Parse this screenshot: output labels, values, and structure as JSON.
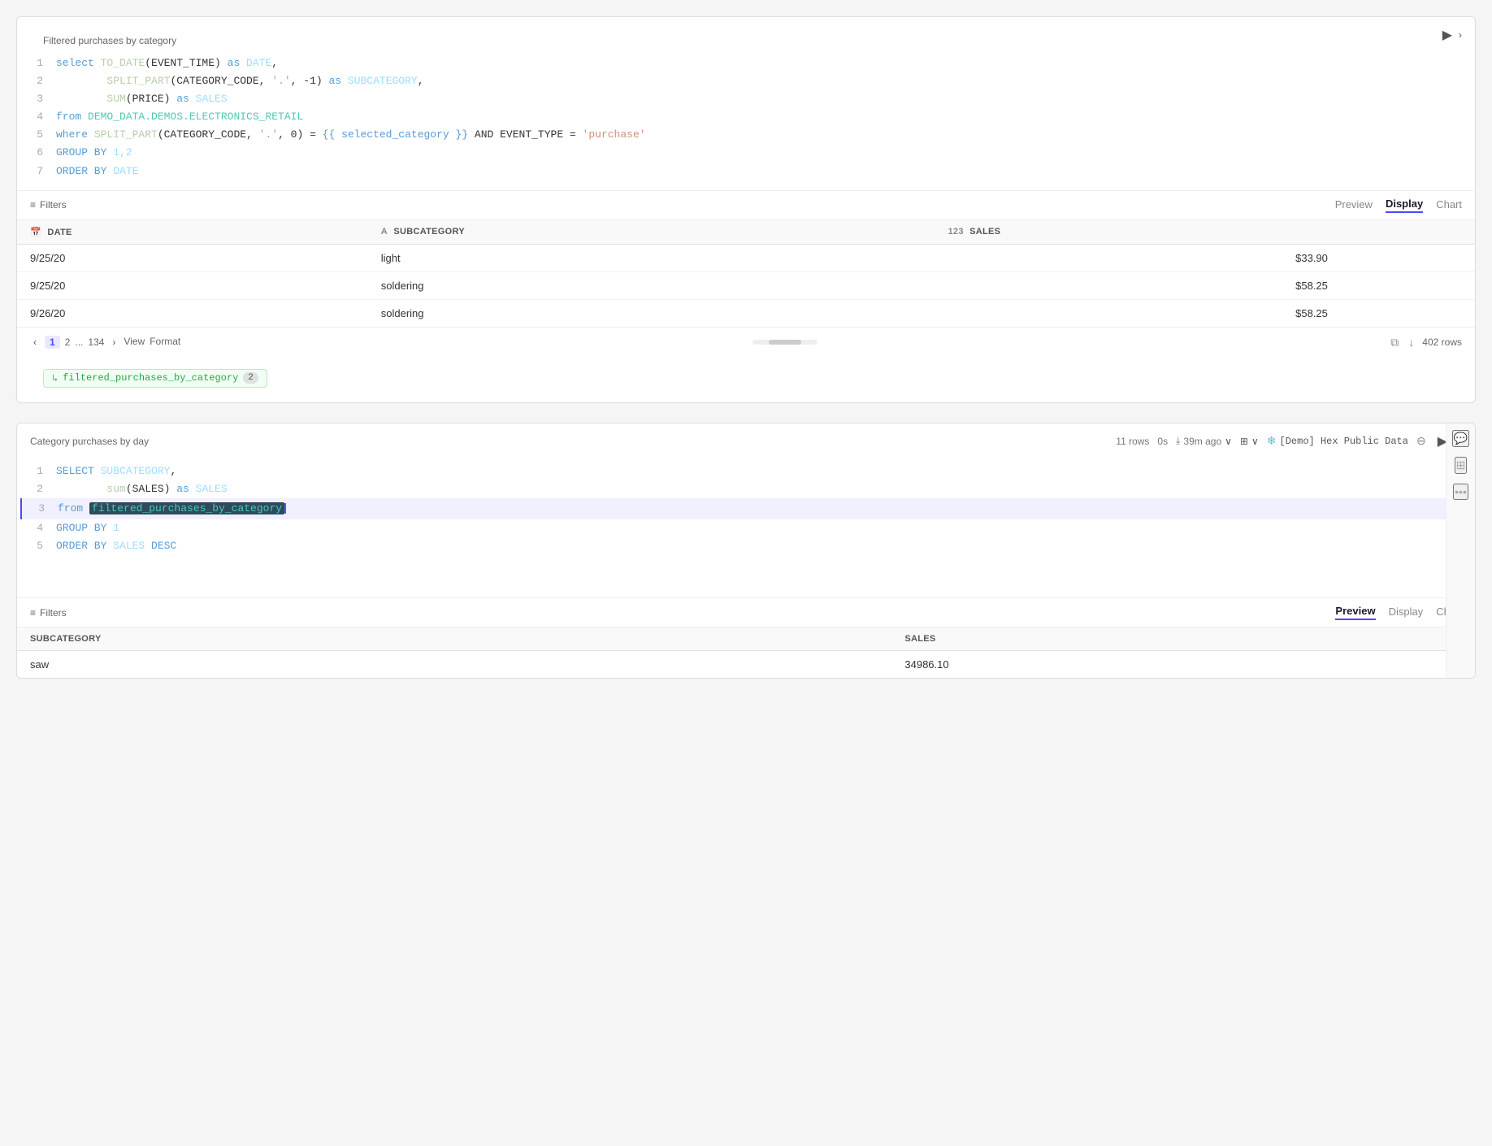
{
  "cell1": {
    "title": "Filtered purchases by category",
    "code": [
      {
        "lineNum": "1",
        "parts": [
          {
            "text": "select ",
            "class": "kw"
          },
          {
            "text": "TO_DATE",
            "class": "fn"
          },
          {
            "text": "(EVENT_TIME) "
          },
          {
            "text": "as ",
            "class": "kw"
          },
          {
            "text": "DATE",
            "class": "col"
          },
          {
            "text": ","
          }
        ]
      },
      {
        "lineNum": "2",
        "parts": [
          {
            "text": "        "
          },
          {
            "text": "SPLIT_PART",
            "class": "fn"
          },
          {
            "text": "(CATEGORY_CODE, "
          },
          {
            "text": "'.'",
            "class": "str"
          },
          {
            "text": ", -1) "
          },
          {
            "text": "as ",
            "class": "kw"
          },
          {
            "text": "SUBCATEGORY",
            "class": "col"
          },
          {
            "text": ","
          }
        ]
      },
      {
        "lineNum": "3",
        "parts": [
          {
            "text": "        "
          },
          {
            "text": "SUM",
            "class": "fn"
          },
          {
            "text": "(PRICE) "
          },
          {
            "text": "as ",
            "class": "kw"
          },
          {
            "text": "SALES",
            "class": "col"
          }
        ]
      },
      {
        "lineNum": "4",
        "parts": [
          {
            "text": "from ",
            "class": "kw"
          },
          {
            "text": "DEMO_DATA.DEMOS.ELECTRONICS_RETAIL",
            "class": "ref"
          }
        ]
      },
      {
        "lineNum": "5",
        "parts": [
          {
            "text": "where ",
            "class": "kw"
          },
          {
            "text": "SPLIT_PART",
            "class": "fn"
          },
          {
            "text": "(CATEGORY_CODE, "
          },
          {
            "text": "'.'",
            "class": "str"
          },
          {
            "text": ", 0) = "
          },
          {
            "text": "{{ selected_category }}",
            "class": "tmpl"
          },
          {
            "text": " AND EVENT_TYPE = "
          },
          {
            "text": "'purchase'",
            "class": "str"
          }
        ]
      },
      {
        "lineNum": "6",
        "parts": [
          {
            "text": "GROUP BY ",
            "class": "kw"
          },
          {
            "text": "1,2",
            "class": "col"
          }
        ]
      },
      {
        "lineNum": "7",
        "parts": [
          {
            "text": "ORDER BY ",
            "class": "kw"
          },
          {
            "text": "DATE",
            "class": "col"
          }
        ]
      }
    ],
    "result": {
      "tabs": [
        "Preview",
        "Display",
        "Chart"
      ],
      "activeTab": "Display",
      "columns": [
        {
          "icon": "📅",
          "label": "DATE"
        },
        {
          "icon": "A",
          "label": "SUBCATEGORY"
        },
        {
          "icon": "123",
          "label": "SALES"
        }
      ],
      "rows": [
        [
          "9/25/20",
          "light",
          "$33.90"
        ],
        [
          "9/25/20",
          "soldering",
          "$58.25"
        ],
        [
          "9/26/20",
          "soldering",
          "$58.25"
        ]
      ],
      "pagination": {
        "current": 1,
        "pages": [
          "1",
          "2",
          "...",
          "134"
        ],
        "totalRows": "402 rows"
      }
    },
    "refTag": "filtered_purchases_by_category",
    "refNum": "2"
  },
  "cell2": {
    "title": "Category purchases by day",
    "meta": {
      "rows": "11 rows",
      "time": "0s",
      "ago": "39m ago",
      "db": "[Demo] Hex Public Data"
    },
    "code": [
      {
        "lineNum": "1",
        "parts": [
          {
            "text": "SELECT ",
            "class": "kw"
          },
          {
            "text": "SUBCATEGORY",
            "class": "col"
          },
          {
            "text": ","
          }
        ]
      },
      {
        "lineNum": "2",
        "parts": [
          {
            "text": "        "
          },
          {
            "text": "sum",
            "class": "fn"
          },
          {
            "text": "(SALES) "
          },
          {
            "text": "as ",
            "class": "kw"
          },
          {
            "text": "SALES",
            "class": "col"
          }
        ]
      },
      {
        "lineNum": "3",
        "highlight": true,
        "parts": [
          {
            "text": "from ",
            "class": "kw"
          },
          {
            "text": "filtered_purchases_by_category",
            "class": "highlighted-ref"
          },
          {
            "text": ""
          }
        ]
      },
      {
        "lineNum": "4",
        "parts": [
          {
            "text": "GROUP BY ",
            "class": "kw"
          },
          {
            "text": "1",
            "class": "col"
          }
        ]
      },
      {
        "lineNum": "5",
        "parts": [
          {
            "text": "ORDER BY ",
            "class": "kw"
          },
          {
            "text": "SALES ",
            "class": "col"
          },
          {
            "text": "DESC",
            "class": "kw"
          }
        ]
      }
    ],
    "result": {
      "tabs": [
        "Preview",
        "Display",
        "Chart"
      ],
      "activeTab": "Preview",
      "columns": [
        {
          "label": "SUBCATEGORY"
        },
        {
          "label": "SALES"
        }
      ],
      "rows": [
        [
          "saw",
          "34986.10"
        ]
      ]
    }
  },
  "icons": {
    "run": "▶",
    "chevron": "›",
    "filters": "≡",
    "copy": "⧉",
    "download": "↓",
    "chat": "💬",
    "table": "⊞",
    "more": "•••",
    "snowflake": "❄",
    "stop": "⊖",
    "back": "‹",
    "forward": "›",
    "arrow": "↳"
  }
}
